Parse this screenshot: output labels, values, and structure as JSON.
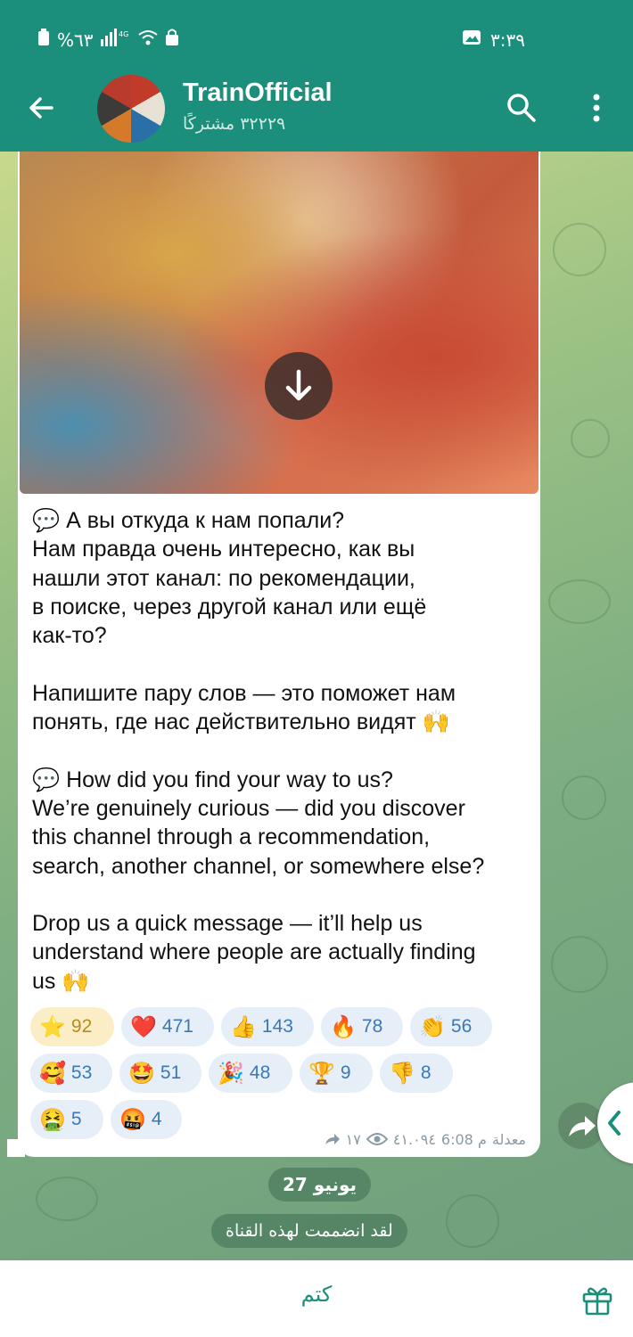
{
  "status_bar": {
    "battery": "%٦٣",
    "time": "٣:٣٩"
  },
  "header": {
    "title": "TrainOfficial",
    "subscribers": "٣٢٢٢٩ مشتركًا"
  },
  "message": {
    "text": "💬 А вы откуда к нам попали?\nНам правда очень интересно, как вы\nнашли этот канал: по рекомендации,\nв поиске, через другой канал или ещё\nкак-то?\n\nНапишите пару слов — это поможет нам\nпонять, где нас действительно видят 🙌\n\n💬 How did you find your way to us?\nWe’re genuinely curious — did you discover\nthis channel through a recommendation,\nsearch, another channel, or somewhere else?\n\nDrop us a quick message — it’ll help us\nunderstand where people are actually finding\nus 🙌",
    "reactions": [
      {
        "emoji": "⭐",
        "count": "92"
      },
      {
        "emoji": "❤️",
        "count": "471"
      },
      {
        "emoji": "👍",
        "count": "143"
      },
      {
        "emoji": "🔥",
        "count": "78"
      },
      {
        "emoji": "👏",
        "count": "56"
      },
      {
        "emoji": "🥰",
        "count": "53"
      },
      {
        "emoji": "🤩",
        "count": "51"
      },
      {
        "emoji": "🎉",
        "count": "48"
      },
      {
        "emoji": "🏆",
        "count": "9"
      },
      {
        "emoji": "👎",
        "count": "8"
      },
      {
        "emoji": "🤮",
        "count": "5"
      },
      {
        "emoji": "🤬",
        "count": "4"
      }
    ],
    "meta": {
      "forwards": "١٧",
      "views": "٤١.٠٩٤",
      "time": "م 6:08",
      "edited": "معدلة"
    }
  },
  "date_separator": "27 يونيو",
  "service_message": "لقد انضممت لهذه القناة",
  "bottom_bar": {
    "mute_label": "كتم"
  },
  "icons": {
    "back": "arrow-left-icon",
    "search": "search-icon",
    "menu": "more-vertical-icon",
    "download": "download-icon",
    "share": "share-icon",
    "side": "chevron-left-icon",
    "gift": "gift-icon",
    "views": "eye-icon",
    "forwards": "forward-arrow-icon"
  },
  "colors": {
    "header": "#1b8f7b",
    "accent": "#1b8f7b",
    "reaction_bg": "#e6eef8",
    "reaction_text": "#3a78b8",
    "star_reaction_bg": "#fbeec7"
  }
}
